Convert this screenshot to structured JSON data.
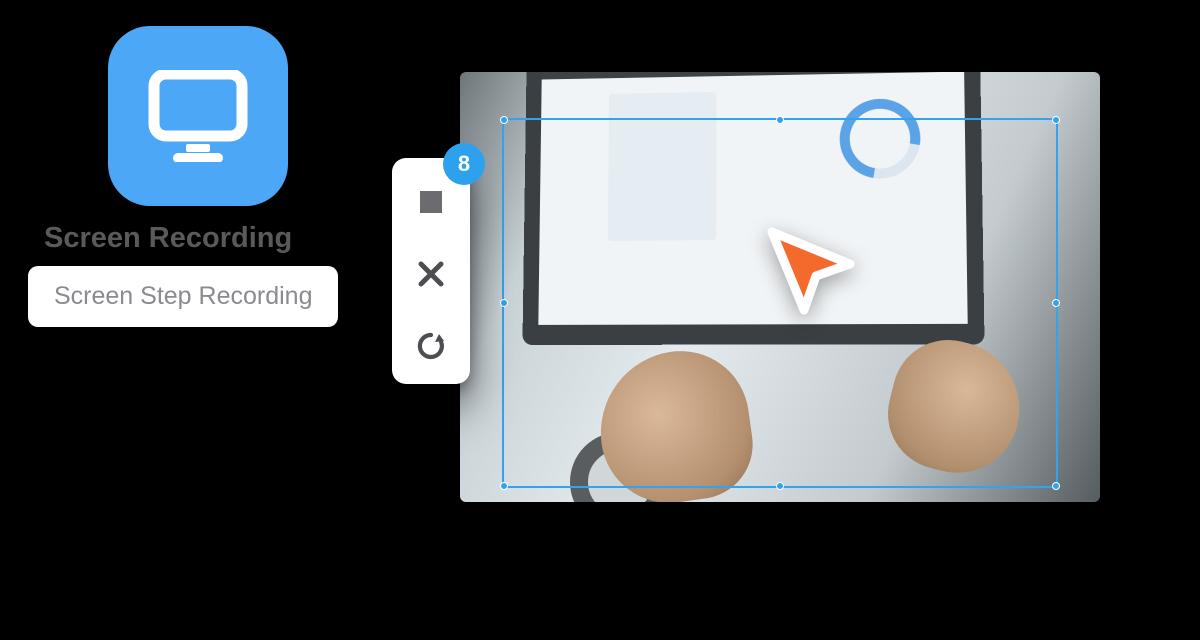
{
  "app_icon": {
    "name": "monitor-icon",
    "accent": "#4da7f7"
  },
  "labels": {
    "back": "Screen Recording",
    "front": "Screen Step Recording"
  },
  "toolbar": {
    "badge_count": "8",
    "items": [
      {
        "name": "stop-icon"
      },
      {
        "name": "close-icon"
      },
      {
        "name": "restart-icon"
      }
    ]
  },
  "selection": {
    "accent": "#31a3ef"
  },
  "cursor": {
    "fill": "#f36a2c",
    "stroke": "#ffffff"
  }
}
